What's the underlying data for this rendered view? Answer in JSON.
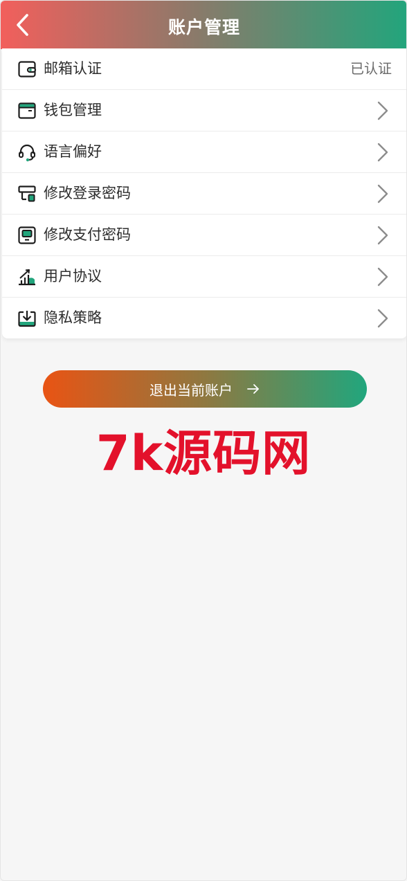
{
  "header": {
    "title": "账户管理",
    "back_icon": "chevron-left-icon"
  },
  "menu": {
    "items": [
      {
        "id": "email",
        "label": "邮箱认证",
        "icon": "wallet-card-icon",
        "value": "已认证",
        "chevron": false
      },
      {
        "id": "wallet",
        "label": "钱包管理",
        "icon": "card-window-icon",
        "value": null,
        "chevron": true
      },
      {
        "id": "language",
        "label": "语言偏好",
        "icon": "headset-icon",
        "value": null,
        "chevron": true
      },
      {
        "id": "login-password",
        "label": "修改登录密码",
        "icon": "desktop-lock-icon",
        "value": null,
        "chevron": true
      },
      {
        "id": "pay-password",
        "label": "修改支付密码",
        "icon": "keypad-icon",
        "value": null,
        "chevron": true
      },
      {
        "id": "agreement",
        "label": "用户协议",
        "icon": "growth-chart-icon",
        "value": null,
        "chevron": true
      },
      {
        "id": "privacy",
        "label": "隐私策略",
        "icon": "download-box-icon",
        "value": null,
        "chevron": true
      }
    ]
  },
  "logout": {
    "label": "退出当前账户",
    "icon": "arrow-right-icon"
  },
  "watermark": {
    "text": "7k源码网"
  },
  "colors": {
    "header_start": "#f25f5c",
    "header_end": "#22a57c",
    "accent_green": "#22a57c",
    "button_start": "#e95414",
    "watermark": "#e3112b"
  }
}
